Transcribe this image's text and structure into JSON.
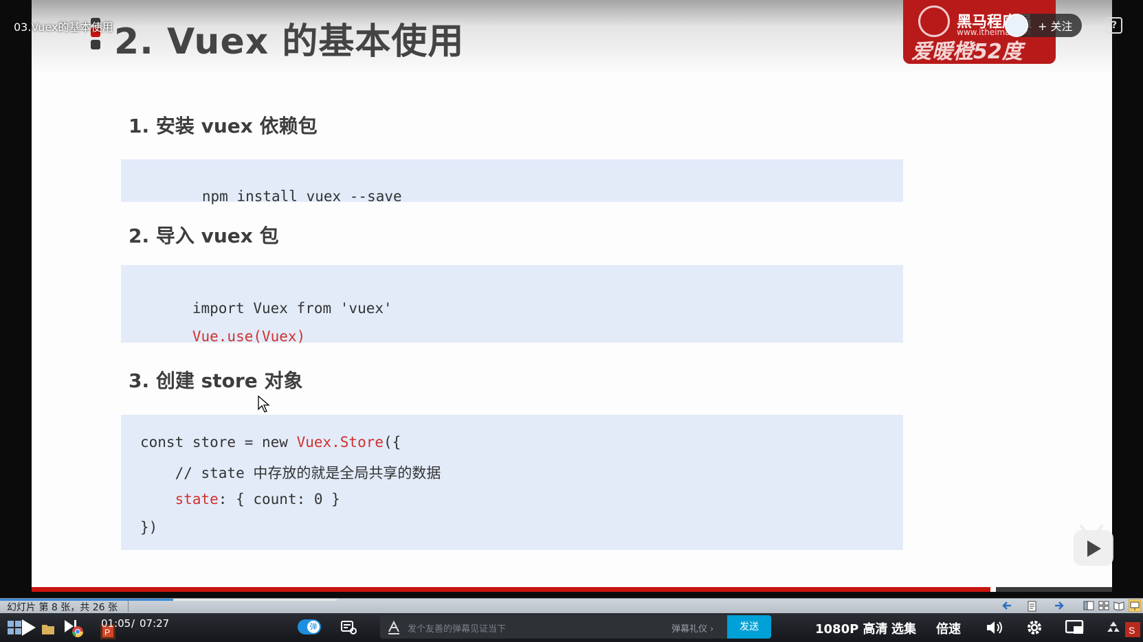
{
  "video": {
    "title": "03.Vuex的基本使用",
    "follow_label": "+ 关注",
    "help_icon": "?"
  },
  "slide": {
    "title": "2. Vuex 的基本使用",
    "logo": {
      "brand": "黑马程序员",
      "url": "www.itheima.com",
      "slogan": "爱暖橙52度"
    },
    "sections": [
      {
        "heading": "1. 安装 vuex 依赖包",
        "code_lines": [
          [
            {
              "text": "npm install vuex --save",
              "color": "normal"
            }
          ]
        ]
      },
      {
        "heading": "2. 导入 vuex 包",
        "code_lines": [
          [
            {
              "text": "import Vuex from 'vuex'",
              "color": "normal"
            }
          ],
          [
            {
              "text": "Vue.use(Vuex)",
              "color": "red"
            }
          ]
        ]
      },
      {
        "heading": "3. 创建 store 对象",
        "code_lines": [
          [
            {
              "text": "const store = new ",
              "color": "normal"
            },
            {
              "text": "Vuex.Store",
              "color": "red"
            },
            {
              "text": "({",
              "color": "normal"
            }
          ],
          [
            {
              "text": "    // state 中存放的就是全局共享的数据",
              "color": "normal"
            }
          ],
          [
            {
              "text": "    ",
              "color": "normal"
            },
            {
              "text": "state",
              "color": "red"
            },
            {
              "text": ": { count: 0 }",
              "color": "normal"
            }
          ],
          [
            {
              "text": "})",
              "color": "normal"
            }
          ]
        ]
      }
    ],
    "colors": {
      "code_bg": "#e3ebf9",
      "accent_red": "#d0312d",
      "marker_red": "#c8140f",
      "marker_dark": "#3a3a3a"
    }
  },
  "ppt_status": {
    "slide_info": "幻灯片 第 8 张，共 26 张"
  },
  "player": {
    "time_current": "01:05",
    "time_sep": "/",
    "time_total": "07:27",
    "danmaku_placeholder": "发个友善的弹幕见证当下",
    "danmaku_etiquette": "弹幕礼仪 ›",
    "send_label": "发送",
    "quality": "1080P 高清",
    "episodes": "选集",
    "speed": "倍速",
    "danmaku_toggle_label": "弹"
  }
}
